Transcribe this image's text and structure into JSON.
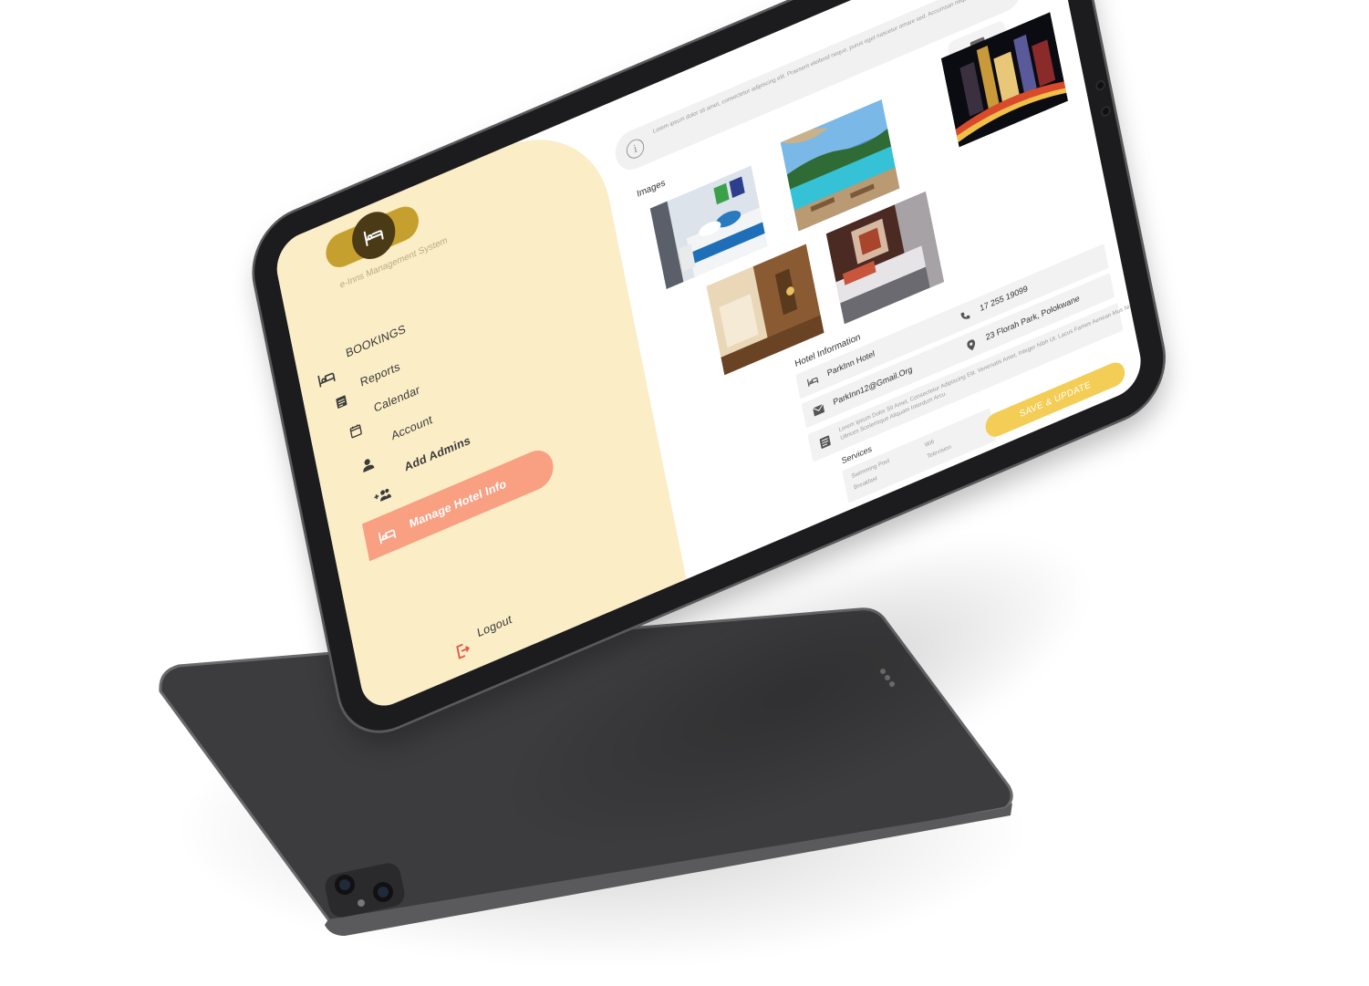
{
  "app": {
    "name": "e-Inns Management System"
  },
  "sidebar": {
    "items": [
      {
        "label": "BOOKINGS",
        "icon": "bed-icon",
        "active": false
      },
      {
        "label": "Reports",
        "icon": "report-icon",
        "active": false
      },
      {
        "label": "Calendar",
        "icon": "calendar-icon",
        "active": false
      },
      {
        "label": "Account",
        "icon": "person-icon",
        "active": false
      },
      {
        "label": "Add Admins",
        "icon": "add-group-icon",
        "active": false
      },
      {
        "label": "Manage Hotel Info",
        "icon": "hotel-icon",
        "active": true
      }
    ],
    "logout_label": "Logout"
  },
  "notice": {
    "text": "Lorem ipsum dolor sit amet, consectetur adipiscing elit. Praesent eleifend neque, purus eget nascetur ornare sed. Accumsan neque."
  },
  "images_section": {
    "title": "Images",
    "photos": [
      "hotel-room-blue",
      "resort-pool",
      "hotel-lobby",
      "hotel-suite",
      "city-night"
    ]
  },
  "hotel_info": {
    "title": "Hotel Information",
    "name": "ParkInn Hotel",
    "email": "ParkInn12@Gmail.Org",
    "phone": "17 255 19099",
    "address": "23 Florah Park, Polokwane",
    "description": "Lorem Ipsum Dolor Sit Amet, Consectetur Adipiscing Elit. Venenatis Amet, Integer Nibh Ut. Lacus Fames Aenean Mus Nisl. Ultrices Scelerisque Aliquam Interdum Arcu."
  },
  "services": {
    "title": "Services",
    "items": [
      "Swimming Pool",
      "Wifi",
      "Breakfast",
      "Television"
    ]
  },
  "actions": {
    "save_label": "SAVE & UPDATE"
  },
  "colors": {
    "sidebar_bg": "#fbedc5",
    "active_item": "#f99f82",
    "logo_gold": "#c6a02f",
    "logo_dark": "#4a3a16",
    "save_button": "#f3cd56",
    "logout_icon": "#e4534a",
    "device_body": "#3c3c3e"
  }
}
